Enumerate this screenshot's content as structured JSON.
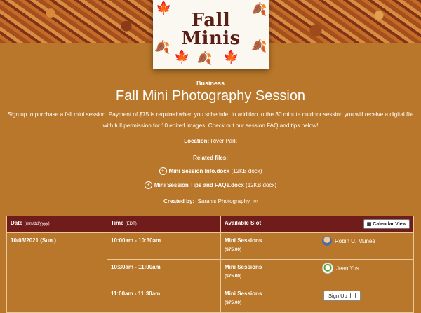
{
  "banner": {
    "cover_title_line1": "Fall",
    "cover_title_line2": "Minis"
  },
  "header": {
    "category": "Business",
    "title": "Fall Mini Photography Session",
    "description_line1": "Sign up to purchase a fall mini session. Payment of $75 is required when you schedule. In addition to the 30 minute outdoor session you will receive a digital file",
    "description_line2": "with full permission for 10 edited images.  Check out our session FAQ and tips below!"
  },
  "location": {
    "label": "Location:",
    "value": "River Park"
  },
  "files": {
    "label": "Related files:",
    "items": [
      {
        "name": "Mini Session Info.docx",
        "meta": "(12KB docx)"
      },
      {
        "name": "Mini Session Tips and FAQs.docx",
        "meta": "(12KB docx)"
      }
    ]
  },
  "created": {
    "label": "Created by:",
    "value": "Sarah's Photography"
  },
  "table": {
    "col_date": "Date",
    "col_date_hint": "(mm/dd/yyyy)",
    "col_time": "Time",
    "col_time_hint": "(EDT)",
    "col_slot": "Available Slot",
    "calendar_view_label": "Calendar View",
    "date": "10/03/2021 (Sun.)",
    "rows": [
      {
        "time": "10:00am - 10:30am",
        "slot": "Mini Sessions",
        "price": "($75.00)",
        "person": "Robin U. Munee"
      },
      {
        "time": "10:30am - 11:00am",
        "slot": "Mini Sessions",
        "price": "($75.00)",
        "person": "Jean Yus"
      },
      {
        "time": "11:00am - 11:30am",
        "slot": "Mini Sessions",
        "price": "($75.00)",
        "action": "Sign Up"
      }
    ]
  },
  "colors": {
    "background": "#b8772a",
    "table_header": "#6f1c1a"
  }
}
